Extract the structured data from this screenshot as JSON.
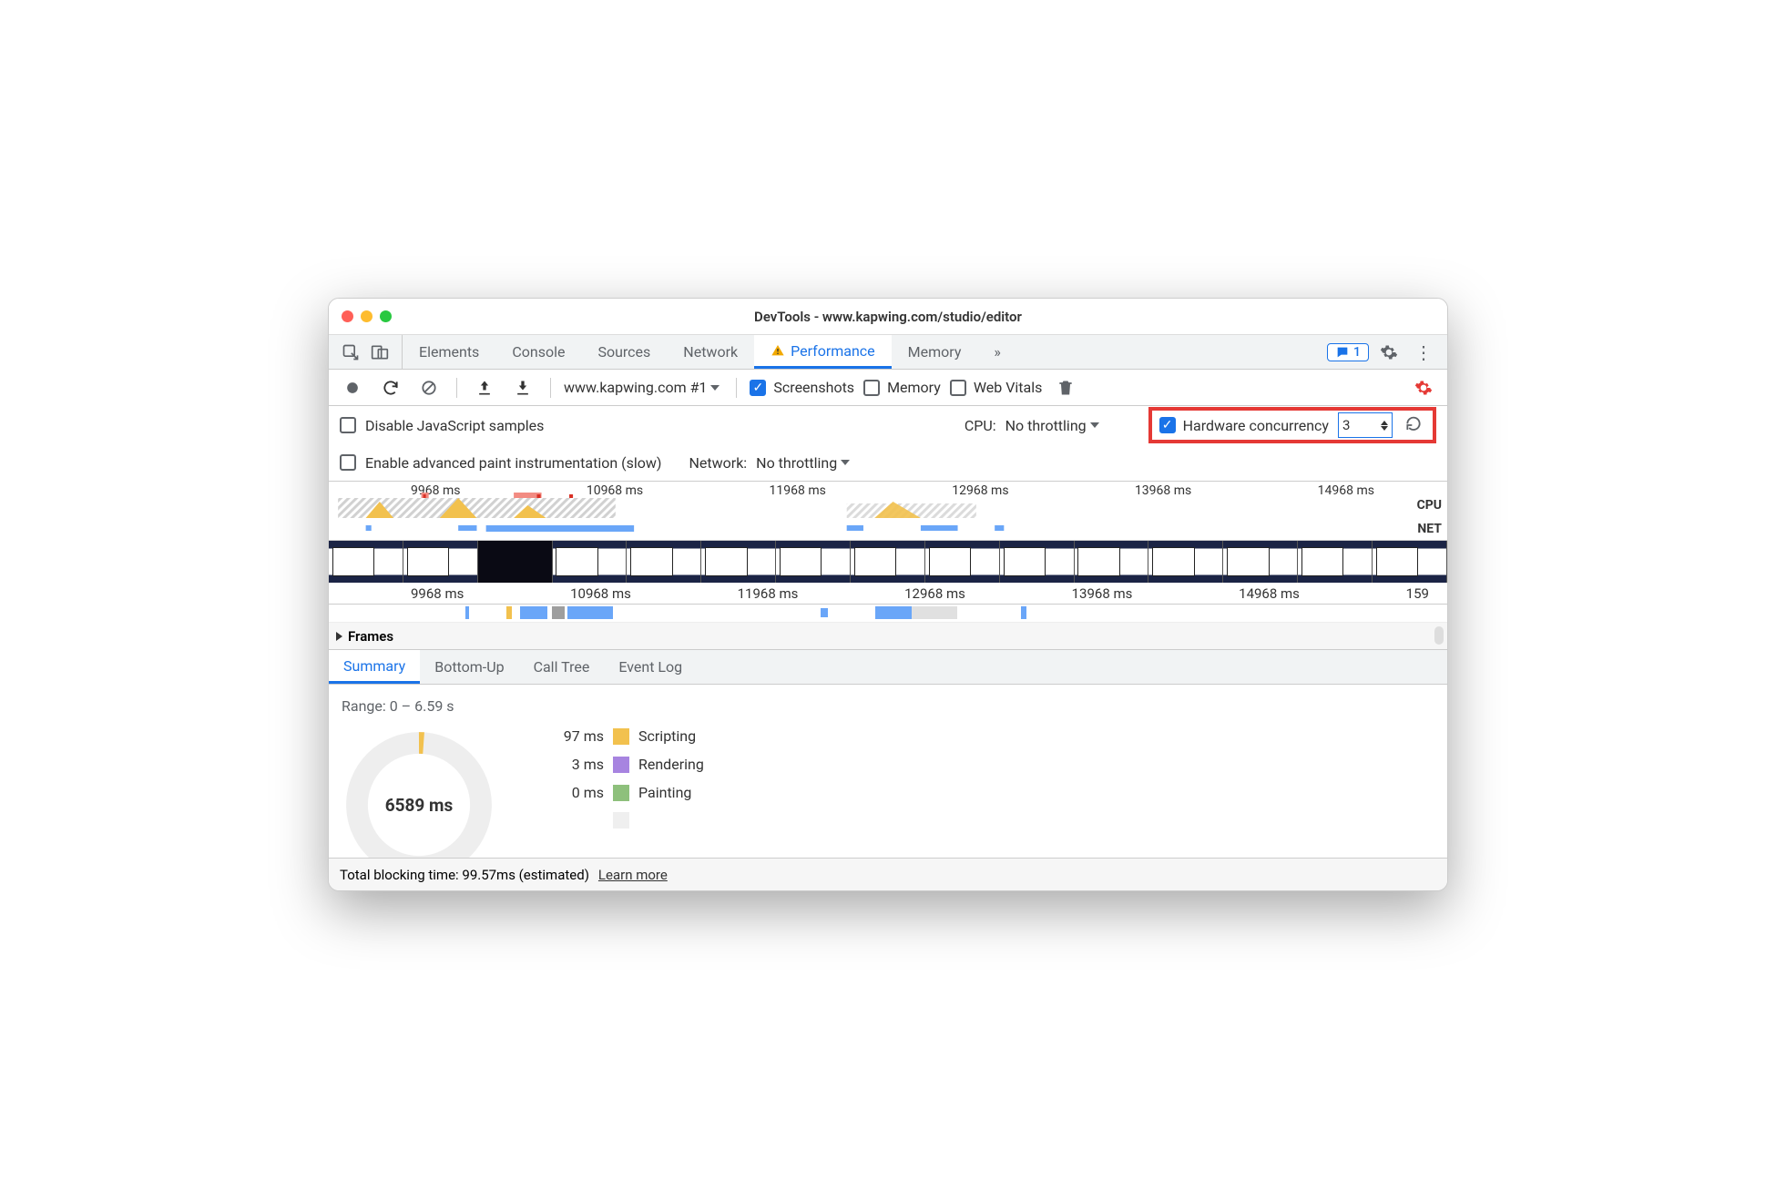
{
  "window_title": "DevTools - www.kapwing.com/studio/editor",
  "tabs": {
    "items": [
      "Elements",
      "Console",
      "Sources",
      "Network",
      "Performance",
      "Memory"
    ],
    "active_index": 4,
    "overflow_icon": "»",
    "perf_warning_icon": "warning-triangle"
  },
  "feedback_badge": {
    "count": "1"
  },
  "toolbar": {
    "page_dropdown": "www.kapwing.com #1",
    "screenshots": {
      "label": "Screenshots",
      "checked": true
    },
    "memory": {
      "label": "Memory",
      "checked": false
    },
    "web_vitals": {
      "label": "Web Vitals",
      "checked": false
    }
  },
  "settings": {
    "disable_js_samples": {
      "label": "Disable JavaScript samples",
      "checked": false
    },
    "cpu_label": "CPU:",
    "cpu_value": "No throttling",
    "hardware_concurrency": {
      "label": "Hardware concurrency",
      "checked": true,
      "value": "3"
    },
    "enable_paint_instr": {
      "label": "Enable advanced paint instrumentation (slow)",
      "checked": false
    },
    "network_label": "Network:",
    "network_value": "No throttling"
  },
  "overview": {
    "ticks": [
      "9968 ms",
      "10968 ms",
      "11968 ms",
      "12968 ms",
      "13968 ms",
      "14968 ms"
    ],
    "cpu_label": "CPU",
    "net_label": "NET"
  },
  "ruler2": {
    "ticks": [
      "9968 ms",
      "10968 ms",
      "11968 ms",
      "12968 ms",
      "13968 ms",
      "14968 ms",
      "159"
    ]
  },
  "section_frames": "Frames",
  "bottom_tabs": {
    "items": [
      "Summary",
      "Bottom-Up",
      "Call Tree",
      "Event Log"
    ],
    "active_index": 0
  },
  "summary": {
    "range_text": "Range: 0 – 6.59 s",
    "total": "6589 ms",
    "legend": [
      {
        "time": "97 ms",
        "label": "Scripting",
        "kind": "scripting"
      },
      {
        "time": "3 ms",
        "label": "Rendering",
        "kind": "rendering"
      },
      {
        "time": "0 ms",
        "label": "Painting",
        "kind": "painting"
      }
    ]
  },
  "footer": {
    "tbt_text": "Total blocking time: 99.57ms (estimated)",
    "learn_more": "Learn more"
  }
}
